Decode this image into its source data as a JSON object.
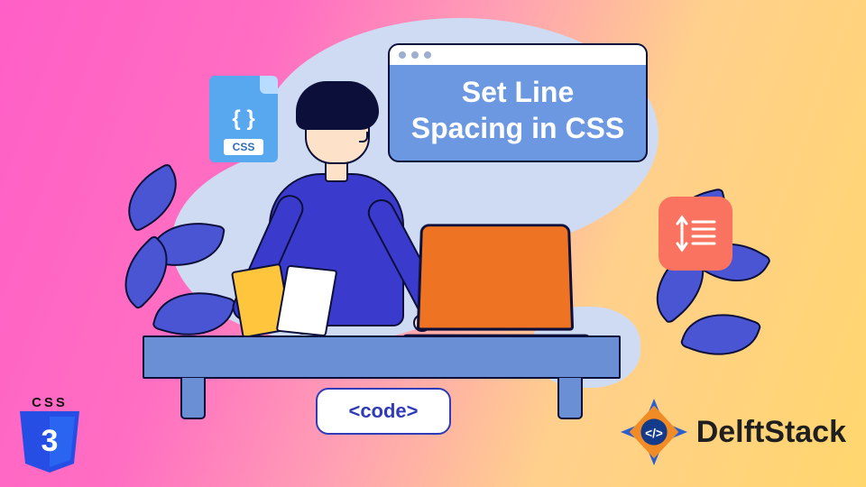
{
  "hero": {
    "window_title": "Set Line Spacing in CSS",
    "code_tag_label": "<code>"
  },
  "file_icon": {
    "braces": "{ }",
    "label": "CSS"
  },
  "css3_badge": {
    "label": "CSS",
    "numeral": "3"
  },
  "brand": {
    "name": "DelftStack"
  },
  "icons": {
    "line_spacing": "line-spacing-icon",
    "code_brackets": "code-icon"
  },
  "colors": {
    "accent_blue": "#3a3bcd",
    "accent_orange": "#ee7322",
    "chip_coral": "#fa7361",
    "file_blue": "#57a8ee",
    "leaf": "#4a55d4"
  }
}
